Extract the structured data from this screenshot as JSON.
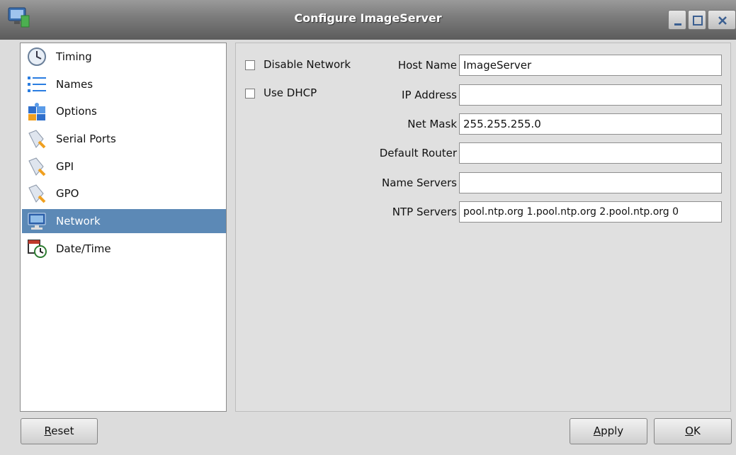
{
  "window": {
    "title": "Configure ImageServer"
  },
  "sidebar": {
    "items": [
      {
        "label": "Timing",
        "icon": "clock-icon"
      },
      {
        "label": "Names",
        "icon": "list-icon"
      },
      {
        "label": "Options",
        "icon": "puzzle-icon"
      },
      {
        "label": "Serial Ports",
        "icon": "plug-icon"
      },
      {
        "label": "GPI",
        "icon": "plug-icon"
      },
      {
        "label": "GPO",
        "icon": "plug-icon"
      },
      {
        "label": "Network",
        "icon": "monitor-icon",
        "selected": true
      },
      {
        "label": "Date/Time",
        "icon": "calendar-clock-icon"
      }
    ]
  },
  "network": {
    "disable_network": {
      "label": "Disable Network",
      "checked": false
    },
    "use_dhcp": {
      "label": "Use DHCP",
      "checked": false
    },
    "fields": {
      "host_name": {
        "label": "Host Name",
        "value": "ImageServer"
      },
      "ip_address": {
        "label": "IP Address",
        "value": ""
      },
      "net_mask": {
        "label": "Net Mask",
        "value": "255.255.255.0"
      },
      "default_router": {
        "label": "Default Router",
        "value": ""
      },
      "name_servers": {
        "label": "Name Servers",
        "value": ""
      },
      "ntp_servers": {
        "label": "NTP Servers",
        "value": "pool.ntp.org  1.pool.ntp.org  2.pool.ntp.org  0"
      }
    }
  },
  "buttons": {
    "reset_first": "R",
    "reset_rest": "eset",
    "apply_first": "A",
    "apply_rest": "pply",
    "ok_first": "O",
    "ok_rest": "K"
  },
  "colors": {
    "selection": "#5c89b6",
    "titlebar": "#7a7a7a"
  }
}
